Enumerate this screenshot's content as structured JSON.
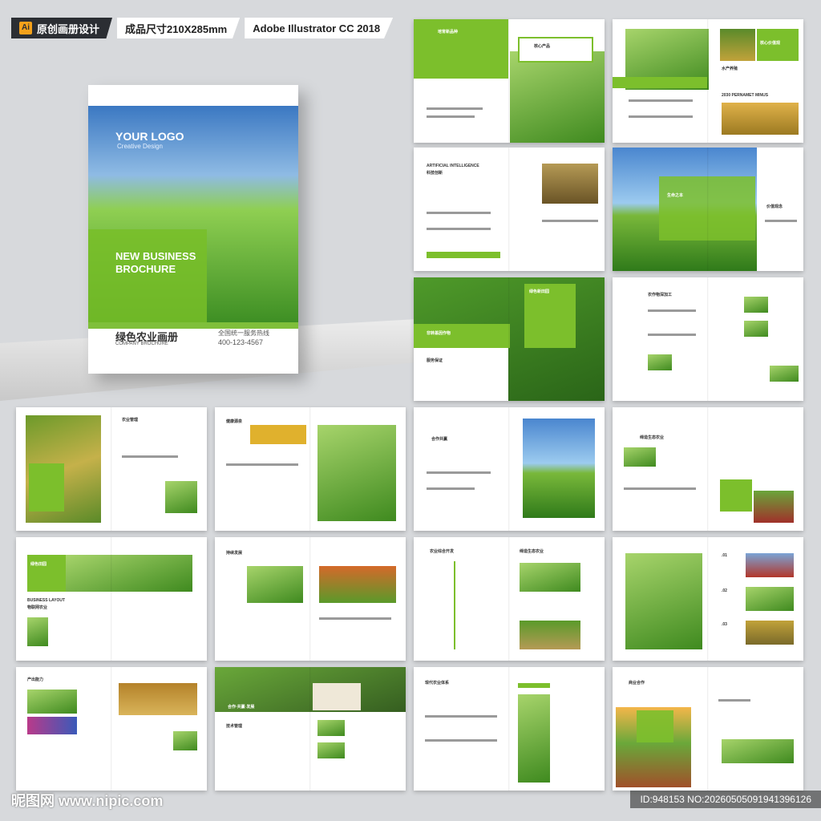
{
  "topbar": {
    "tag1": "原创画册设计",
    "tag2": "成品尺寸210X285mm",
    "tag3": "Adobe Illustrator CC 2018",
    "ai_icon": "Ai"
  },
  "cover": {
    "logo": "YOUR LOGO",
    "logo_sub": "Creative Design",
    "title": "NEW BUSINESS BROCHURE",
    "cn_title": "绿色农业画册",
    "cn_sub": "COMPANY BROCHURE",
    "hotline": "全国统一服务热线",
    "phone": "400-123-4567"
  },
  "pages": [
    {
      "h1": "培育新品种",
      "h2": "核心产品"
    },
    {
      "h1": "核心价值观",
      "h2": "水产养殖",
      "h3": "2030 PERNAMET MINUS"
    },
    {
      "h1": "ARTIFICIAL INTELLIGENCE",
      "h2": "科技创新"
    },
    {
      "h1": "生命之本",
      "h2": "价值观念"
    },
    {
      "h1": "绿色新田园",
      "h2": "非转基因作物",
      "h3": "服务保证"
    },
    {
      "h1": "农作物深加工"
    },
    {
      "h1": "农业管理"
    },
    {
      "h1": "健康源泉"
    },
    {
      "h1": "合作共赢"
    },
    {
      "h1": "缔造生态农业"
    },
    {
      "h1": "绿色田园",
      "h2": "BUSINESS LAYOUT",
      "h3": "物联网农业"
    },
    {
      "h1": "持续发展"
    },
    {
      "h1": "农业综合开发",
      "h2": "缔造生态农业"
    },
    {
      "h1": ".01",
      "h2": ".02",
      "h3": ".03"
    },
    {
      "h1": "产出能力"
    },
    {
      "h1": "合作·共赢·发展",
      "h2": "技术管理"
    },
    {
      "h1": "现代农业体系"
    },
    {
      "h1": "商业合作"
    }
  ],
  "watermark": "昵图网 www.nipic.com",
  "image_id": "ID:948153 NO:20260505091941396126"
}
